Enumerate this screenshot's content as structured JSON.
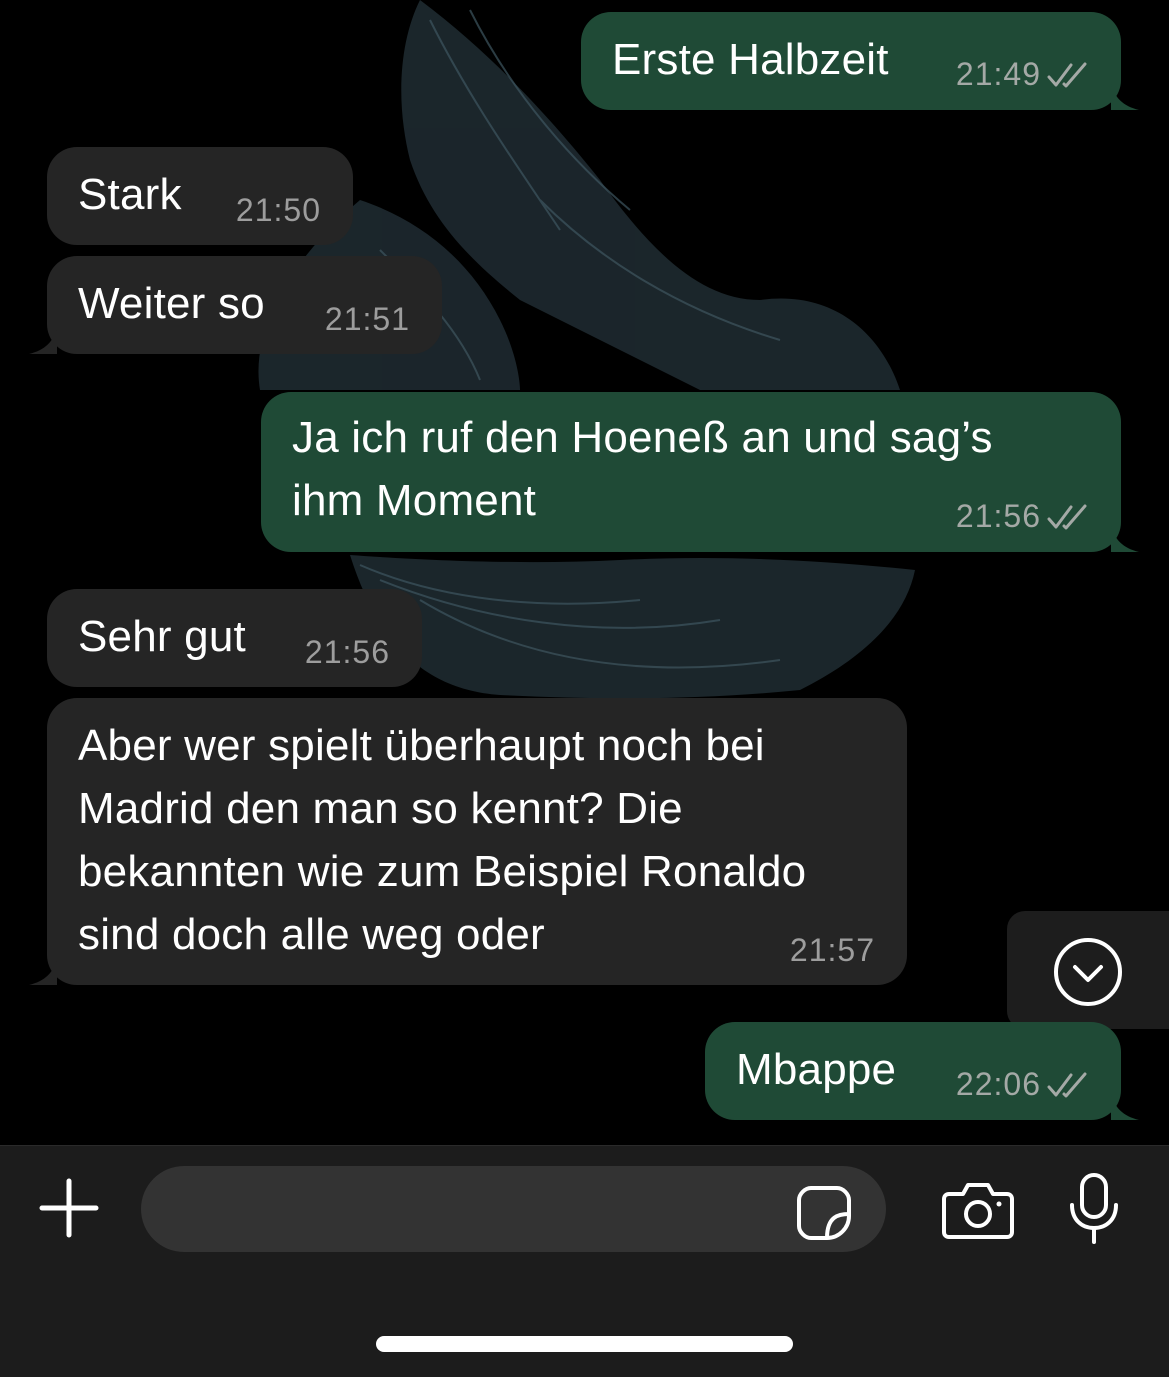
{
  "messages": [
    {
      "text": "Erste Halbzeit",
      "time": "21:49",
      "direction": "outgoing",
      "status": "read"
    },
    {
      "text": "Stark",
      "time": "21:50",
      "direction": "incoming"
    },
    {
      "text": "Weiter so",
      "time": "21:51",
      "direction": "incoming"
    },
    {
      "lines": [
        "Ja ich ruf den Hoeneß an und sag’s",
        "ihm Moment"
      ],
      "time": "21:56",
      "direction": "outgoing",
      "status": "read"
    },
    {
      "text": "Sehr gut",
      "time": "21:56",
      "direction": "incoming"
    },
    {
      "lines": [
        "Aber wer spielt überhaupt noch bei",
        "Madrid den man so kennt? Die",
        "bekannten wie zum Beispiel Ronaldo",
        "sind doch alle weg oder"
      ],
      "time": "21:57",
      "direction": "incoming"
    },
    {
      "text": "Mbappe",
      "time": "22:06",
      "direction": "outgoing",
      "status": "read"
    }
  ],
  "composer": {
    "input_value": "",
    "icons": [
      "plus-icon",
      "sticker-icon",
      "camera-icon",
      "microphone-icon"
    ]
  },
  "colors": {
    "background": "#000000",
    "incoming_bubble": "#252525",
    "outgoing_bubble": "#1f4a36",
    "timestamp": "#a4a9a6",
    "composer_bar": "#1c1c1c",
    "input_field": "#333333"
  }
}
